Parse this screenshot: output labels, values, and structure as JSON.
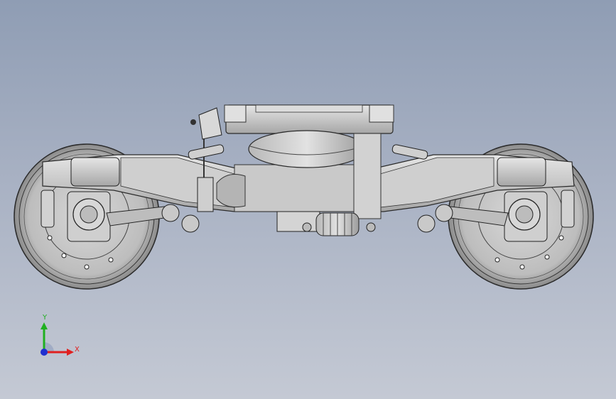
{
  "triad": {
    "x_label": "X",
    "y_label": "Y"
  },
  "colors": {
    "x_axis": "#e02020",
    "y_axis": "#20b020",
    "z_axis": "#2030d0",
    "part_fill": "#c8c8c8",
    "part_stroke": "#303030"
  },
  "icons": [
    "coordinate-triad-icon"
  ]
}
